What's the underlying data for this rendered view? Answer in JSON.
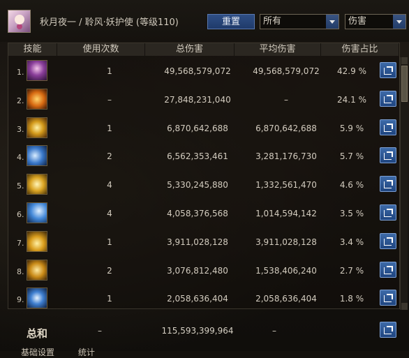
{
  "header": {
    "character_title": "秋月夜一 / 聆风·妖护使 (等级110)",
    "reset_button": "重置",
    "filter_all": "所有",
    "filter_damage": "伤害"
  },
  "table": {
    "columns": [
      "技能",
      "使用次数",
      "总伤害",
      "平均伤害",
      "伤害占比"
    ],
    "rows": [
      {
        "index": "1.",
        "uses": "1",
        "total": "49,568,579,072",
        "average": "49,568,579,072",
        "share": "42.9 %",
        "icon": "skill-icon-purple-figure"
      },
      {
        "index": "2.",
        "uses": "–",
        "total": "27,848,231,040",
        "average": "–",
        "share": "24.1 %",
        "icon": "skill-icon-fire-figure"
      },
      {
        "index": "3.",
        "uses": "1",
        "total": "6,870,642,688",
        "average": "6,870,642,688",
        "share": "5.9 %",
        "icon": "skill-icon-gold-burst"
      },
      {
        "index": "4.",
        "uses": "2",
        "total": "6,562,353,461",
        "average": "3,281,176,730",
        "share": "5.7 %",
        "icon": "skill-icon-blue-wind"
      },
      {
        "index": "5.",
        "uses": "4",
        "total": "5,330,245,880",
        "average": "1,332,561,470",
        "share": "4.6 %",
        "icon": "skill-icon-gold-claw"
      },
      {
        "index": "6.",
        "uses": "4",
        "total": "4,058,376,568",
        "average": "1,014,594,142",
        "share": "3.5 %",
        "icon": "skill-icon-blue-slash"
      },
      {
        "index": "7.",
        "uses": "1",
        "total": "3,911,028,128",
        "average": "3,911,028,128",
        "share": "3.4 %",
        "icon": "skill-icon-gold-spikes"
      },
      {
        "index": "8.",
        "uses": "2",
        "total": "3,076,812,480",
        "average": "1,538,406,240",
        "share": "2.7 %",
        "icon": "skill-icon-gold-strike"
      },
      {
        "index": "9.",
        "uses": "1",
        "total": "2,058,636,404",
        "average": "2,058,636,404",
        "share": "1.8 %",
        "icon": "skill-icon-blue-vortex"
      }
    ],
    "total": {
      "label": "总和",
      "uses": "–",
      "total": "115,593,399,964",
      "average": "–"
    }
  },
  "bottom": {
    "tab_settings": "基础设置",
    "tab_stats": "统计"
  },
  "colors": {
    "accent_blue": "#2f4f86",
    "header_bg": "#2b2721"
  }
}
